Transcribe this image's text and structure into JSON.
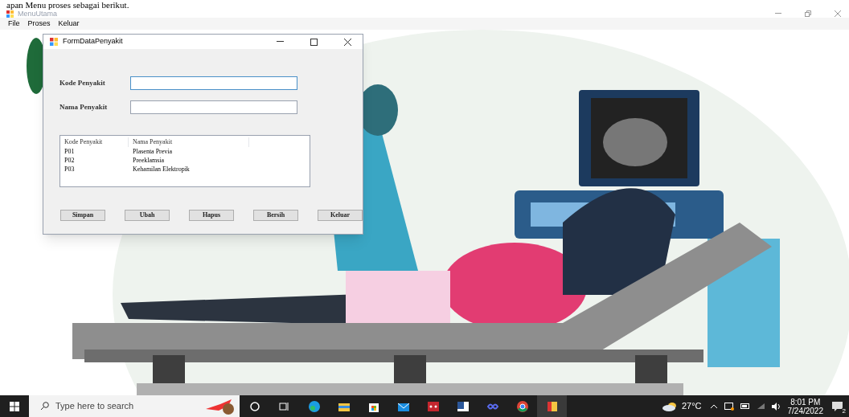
{
  "document_text": "apan Menu proses sebagai berikut.",
  "window": {
    "title": "MenuUtama"
  },
  "menu_bar": [
    {
      "label": "File"
    },
    {
      "label": "Proses"
    },
    {
      "label": "Keluar"
    }
  ],
  "child_form": {
    "title": "FormDataPenyakit",
    "fields": [
      {
        "label": "Kode Penyakit",
        "focused": true
      },
      {
        "label": "Nama Penyakit",
        "focused": false
      }
    ],
    "table": {
      "columns": [
        "Kode Penyakit",
        "Nama Penyakit"
      ],
      "rows": [
        [
          "P01",
          "Plasenta Previa"
        ],
        [
          "P02",
          "Preeklamsia"
        ],
        [
          "P03",
          "Kehamilan Elektropik"
        ]
      ]
    },
    "buttons": [
      "Simpan",
      "Ubah",
      "Hapus",
      "Bersih",
      "Keluar"
    ]
  },
  "taskbar": {
    "search_placeholder": "Type here to search",
    "apps": [
      {
        "kind": "cortana"
      },
      {
        "kind": "taskview"
      },
      {
        "kind": "edge"
      },
      {
        "kind": "folder"
      },
      {
        "kind": "store"
      },
      {
        "kind": "mail"
      },
      {
        "kind": "red"
      },
      {
        "kind": "word"
      },
      {
        "kind": "infinity"
      },
      {
        "kind": "chrome"
      },
      {
        "kind": "form",
        "selected": true
      }
    ],
    "temperature": "27°C",
    "time": "8:01 PM",
    "date": "7/24/2022",
    "notifications": "2"
  }
}
